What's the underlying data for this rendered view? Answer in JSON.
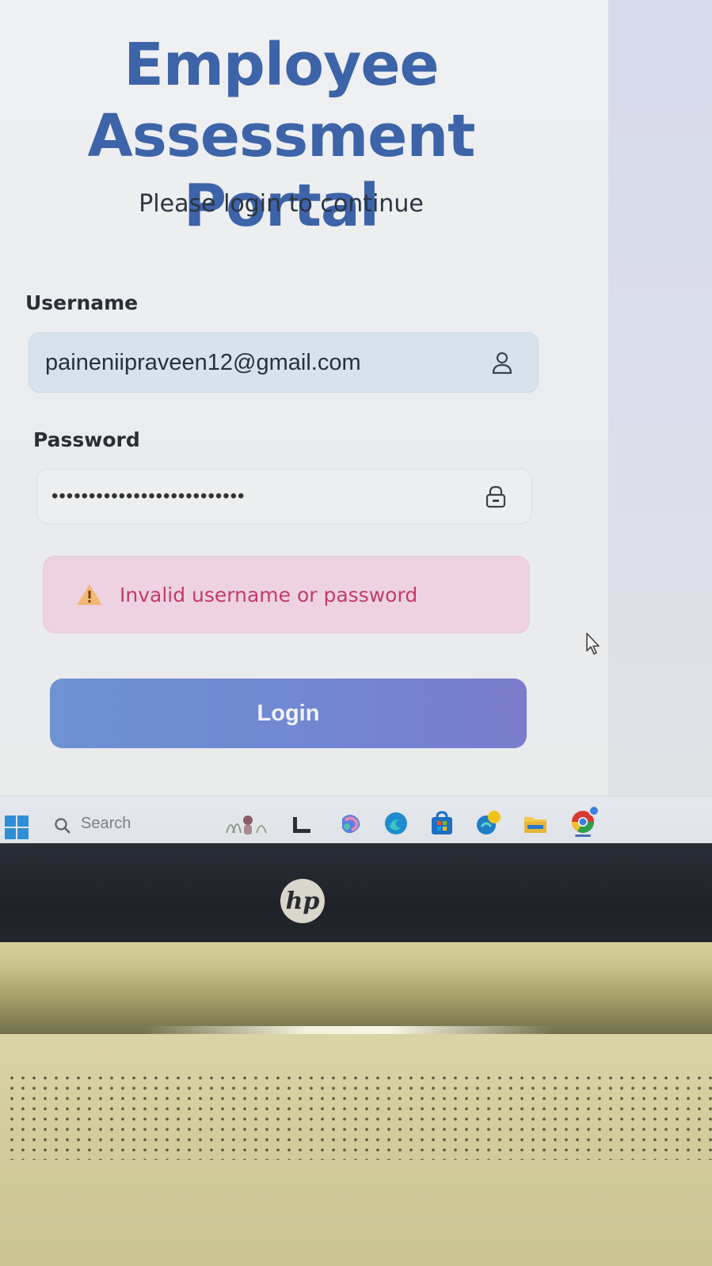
{
  "portal": {
    "title_line1": "Employee",
    "title_line2": "Assessment Portal",
    "subtitle": "Please login to continue"
  },
  "form": {
    "username_label": "Username",
    "username_value": "paineniipraveen12@gmail.com",
    "password_label": "Password",
    "password_value": "••••••••••••••••••••••••••",
    "error_message": "Invalid username or password",
    "login_label": "Login"
  },
  "taskbar": {
    "search_placeholder": "Search",
    "icons": [
      "start-icon",
      "search-icon",
      "widgets-icon",
      "terminal-icon",
      "copilot-icon",
      "edge-icon",
      "store-icon",
      "weather-icon",
      "file-explorer-icon",
      "chrome-icon"
    ]
  },
  "colors": {
    "title": "#3d63a8",
    "error_bg": "#eed2e1",
    "error_text": "#c33b6a",
    "button_start": "#6e92d4",
    "button_end": "#7a7ccc"
  }
}
